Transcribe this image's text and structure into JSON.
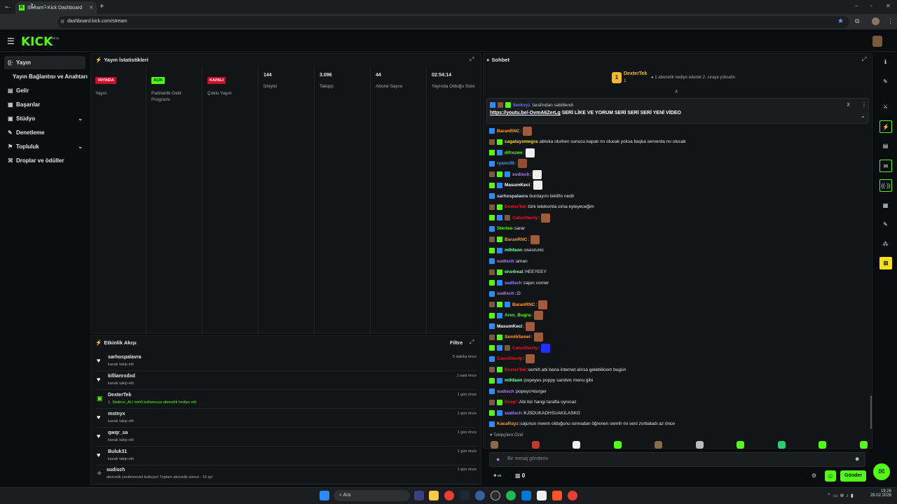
{
  "browser": {
    "tab_title": "Stream - Kick Dashboard",
    "url": "dashboard.kick.com/stream",
    "min": "–",
    "max": "▫",
    "close": "✕"
  },
  "brand": {
    "logo": "KICK",
    "tm": "BETA",
    "accent": "#53fc18"
  },
  "sidebar": {
    "items": [
      {
        "label": "Yayın",
        "icon": "radio-icon"
      },
      {
        "label": "Yayın Bağlantısı ve Anahtarı",
        "icon": "key-icon"
      },
      {
        "label": "Gelir",
        "icon": "money-icon"
      },
      {
        "label": "Başarılar",
        "icon": "trophy-icon"
      },
      {
        "label": "Stüdyo",
        "icon": "studio-icon"
      },
      {
        "label": "Denetleme",
        "icon": "wrench-icon"
      },
      {
        "label": "Topluluk",
        "icon": "community-icon"
      },
      {
        "label": "Droplar ve ödüller",
        "icon": "gift-icon"
      }
    ]
  },
  "stats": {
    "title": "Yayın İstatistikleri",
    "columns": [
      {
        "badge": "YAYINDA",
        "label": "Yayın"
      },
      {
        "badge": "AÇIK",
        "label": "Partnerlik Gelir Programı"
      },
      {
        "badge": "KAPALI",
        "label": "Çoklu Yayın"
      },
      {
        "value": "144",
        "label": "İzleyici"
      },
      {
        "value": "3.096",
        "label": "Takipçi"
      },
      {
        "value": "44",
        "label": "Abone Sayısı"
      },
      {
        "value": "02:54:14",
        "label": "Yayında Olduğu Süre"
      }
    ]
  },
  "activity": {
    "title": "Etkinlik Akışı",
    "filter": "Filtre",
    "events": [
      {
        "name": "sarhospalavra",
        "sub": "kanalı takip etti",
        "time": "5 dakika önce",
        "icon": "heart"
      },
      {
        "name": "killianrxdxd",
        "sub": "kanalı takip etti",
        "time": "1 saat önce",
        "icon": "heart"
      },
      {
        "name": "DexterTek",
        "sub": "1. Sadece_ALI isimli kullanıcıya abonelik hediye etti.",
        "time": "1 gün önce",
        "icon": "gift"
      },
      {
        "name": "mstnyx",
        "sub": "kanalı takip etti",
        "time": "1 gün önce",
        "icon": "heart"
      },
      {
        "name": "qwqr_sa",
        "sub": "kanalı takip etti",
        "time": "1 gün önce",
        "icon": "heart"
      },
      {
        "name": "Buluk31",
        "sub": "kanalı takip etti",
        "time": "1 gün önce",
        "icon": "heart"
      },
      {
        "name": "sudisch",
        "sub": "abonelik yenilemesini kutluyor! Toplam abonelik süresi - 10 ay!",
        "time": "1 gün önce",
        "icon": "star"
      }
    ]
  },
  "chat": {
    "title": "Sohbet",
    "top_gifter": {
      "rank": "1",
      "name": "DexterTek",
      "count": "1",
      "hint": "1 abonelik hediye ederek 2. sıraya yükselin"
    },
    "pinned": {
      "by": "Serkvyz",
      "by_suffix": "tarafından sabitlendi",
      "link": "https://youtu.be/-OvmA6ZerLg",
      "text": "SERİ LİKE VE YORUM SERİ SERİ SERİ YENİ VİDEO"
    },
    "messages": [
      {
        "user": "BaranRNC",
        "color": "#ff9d2e",
        "text": "",
        "emote": "#a05a3c"
      },
      {
        "user": "cagataysmegra",
        "color": "#ffd54a",
        "text": "abluka olurken sunucu kapalı mı olucak yoksa başka serverda mı olucak"
      },
      {
        "user": "difrozen",
        "color": "#53fc18",
        "text": "",
        "emote": "#eeeeee"
      },
      {
        "user": "ryann36",
        "color": "#3aa0ff",
        "text": "",
        "emote": "#9a4a34"
      },
      {
        "user": "sudisch",
        "color": "#b080ff",
        "text": "",
        "emote": "#eeeeee"
      },
      {
        "user": "MasumKeci",
        "color": "#ffffff",
        "text": "",
        "emote": "#eeeeee"
      },
      {
        "user": "sarhospalavra",
        "color": "#cfd8ff",
        "text": "burdayım teklifin nedir"
      },
      {
        "user": "DexterTek",
        "color": "#e0152e",
        "text": "türk telekomla cima eyleyeceğim"
      },
      {
        "user": "CansSherty",
        "color": "#e0152e",
        "text": "",
        "emote": "#a05a3c"
      },
      {
        "user": "Sterioo",
        "color": "#53fc18",
        "text": "sarar"
      },
      {
        "user": "BaranRNC",
        "color": "#ff9d2e",
        "text": "",
        "emote": "#a05a3c"
      },
      {
        "user": "mlhfaon",
        "color": "#7cffb0",
        "text": "osesrunic"
      },
      {
        "user": "sudisch",
        "color": "#b080ff",
        "text": "aman"
      },
      {
        "user": "ens4real",
        "color": "#7cffb0",
        "text": "HEEYEEY"
      },
      {
        "user": "sudisch",
        "color": "#b080ff",
        "text": "cajun corner"
      },
      {
        "user": "sudisch",
        "color": "#b080ff",
        "text": ":D"
      },
      {
        "user": "BaranRNC",
        "color": "#ff9d2e",
        "text": "",
        "emote": "#a05a3c"
      },
      {
        "user": "Aren_Bugra",
        "color": "#53fc18",
        "text": "",
        "emote": "#a05a3c"
      },
      {
        "user": "MasumKeci",
        "color": "#ffffff",
        "text": "",
        "emote": "#a05a3c"
      },
      {
        "user": "SemihSenel",
        "color": "#ff9d2e",
        "text": "",
        "emote": "#a05a3c"
      },
      {
        "user": "CansSherty",
        "color": "#e0152e",
        "text": "",
        "emote": "#2230ff"
      },
      {
        "user": "CansSherty",
        "color": "#e0152e",
        "text": "",
        "emote": "#a05a3c"
      },
      {
        "user": "DexterTek",
        "color": "#e0152e",
        "text": "semih abi bana internet alırsa gelebilicem bugün"
      },
      {
        "user": "mlhfaon",
        "color": "#7cffb0",
        "text": "popeyes poppy sandvic menu gibi"
      },
      {
        "user": "sudisch",
        "color": "#b080ff",
        "text": "popeys>burger"
      },
      {
        "user": "Deep!",
        "color": "#e0152e",
        "text": "Abi biz hangi tarafta oynıcaz"
      },
      {
        "user": "sudisch",
        "color": "#b080ff",
        "text": "KJSDUKADHSUAKILASKG"
      },
      {
        "user": "KacaRayz",
        "color": "#ff9d2e",
        "text": "cajunun meem olduğunu sonradan öğrenen semih mi seni zorbaladı az önce"
      }
    ],
    "followers_only": "Takipçilere Özel",
    "input_placeholder": "Bir mesaj gönderin",
    "infinity": "∞",
    "count": "0",
    "send": "Gönder"
  },
  "taskbar": {
    "search": "Ara",
    "time": "19:26",
    "date": "28.02.2026"
  }
}
